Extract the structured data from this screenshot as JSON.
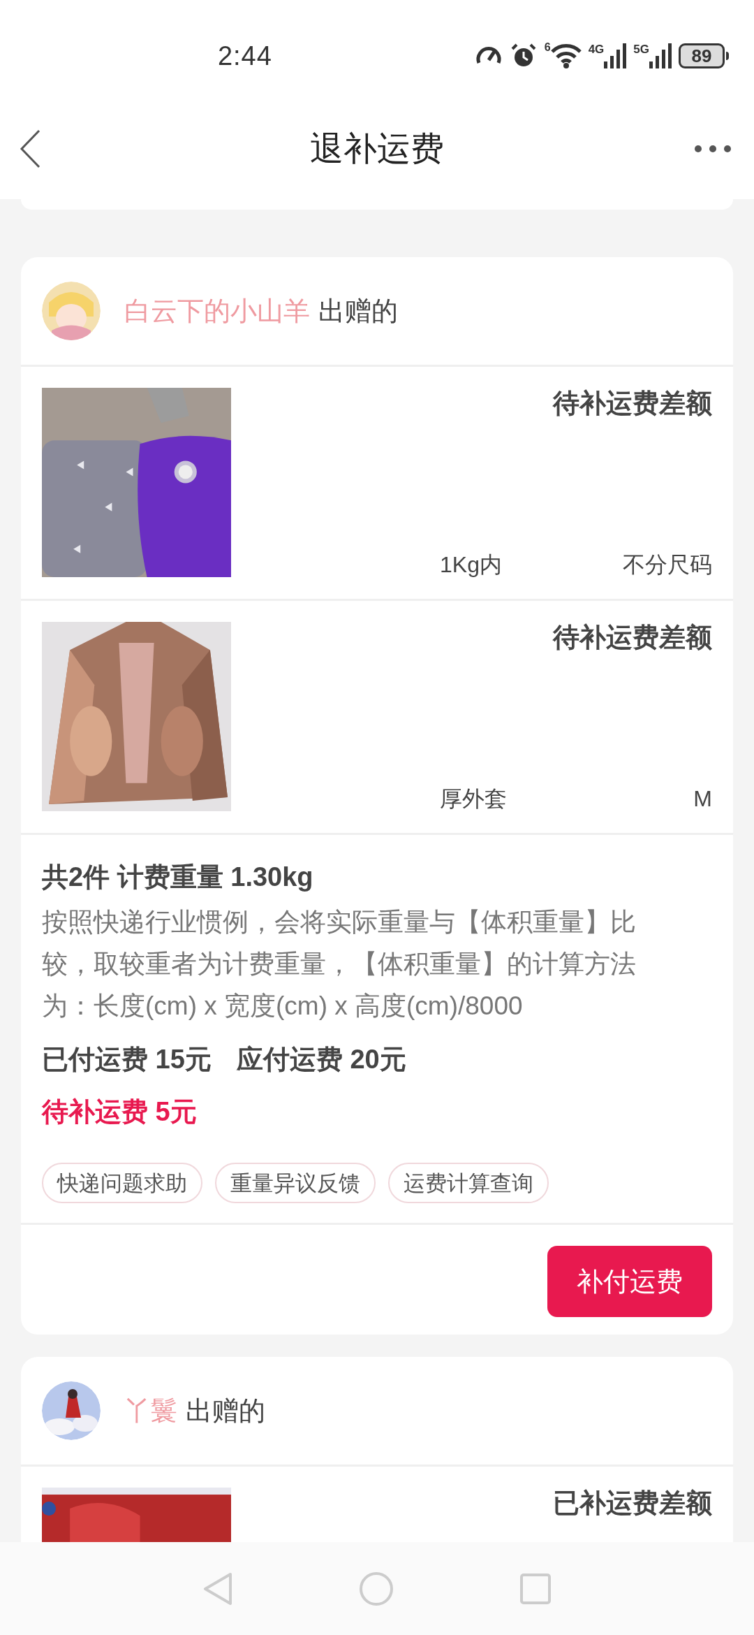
{
  "status_bar": {
    "time": "2:44",
    "wifi_badge": "6",
    "network_1": "4G",
    "network_2": "5G",
    "battery": "89"
  },
  "header": {
    "title": "退补运费"
  },
  "orders": [
    {
      "giver": "白云下的小山羊",
      "suffix": "出赠的",
      "items": [
        {
          "status": "待补运费差额",
          "spec_1": "1Kg内",
          "spec_2": "不分尺码"
        },
        {
          "status": "待补运费差额",
          "spec_1": "厚外套",
          "spec_2": "M"
        }
      ],
      "summary": {
        "count_weight": "共2件 计费重量 1.30kg",
        "note": "按照快递行业惯例，会将实际重量与【体积重量】比较，取较重者为计费重量，【体积重量】的计算方法为：长度(cm) x 宽度(cm) x 高度(cm)/8000",
        "fees": [
          "已付运费 15元",
          "应付运费 20元"
        ],
        "due": "待补运费 5元"
      },
      "tags": [
        "快递问题求助",
        "重量异议反馈",
        "运费计算查询"
      ],
      "action": "补付运费"
    },
    {
      "giver": "丫鬟",
      "suffix": "出赠的",
      "items": [
        {
          "status": "已补运费差额"
        }
      ]
    }
  ]
}
